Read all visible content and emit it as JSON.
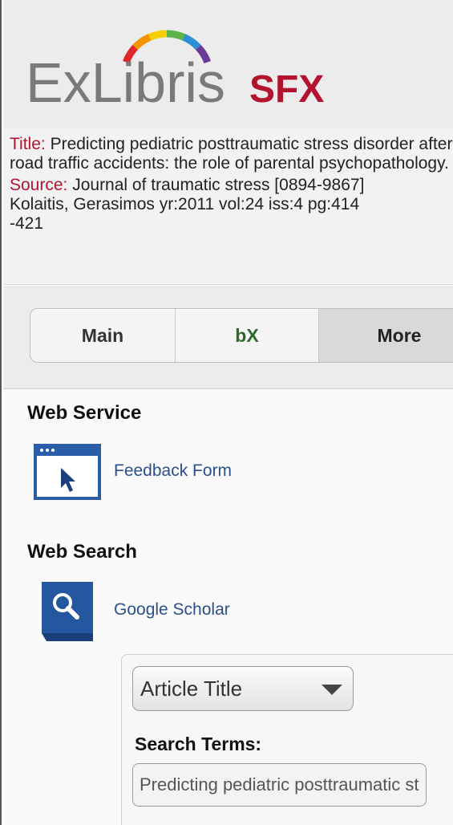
{
  "brand": {
    "name": "ExLibris",
    "product": "SFX",
    "arc_colors": [
      "#e0262a",
      "#f29300",
      "#f5cf00",
      "#5ab447",
      "#2a8fd4",
      "#6a3c97"
    ]
  },
  "citation": {
    "title_label": "Title:",
    "title_value": " Predicting pediatric posttraumatic stress disorder after road traffic accidents: the role of parental psychopathology.",
    "source_label": "Source:",
    "source_line1": " Journal of traumatic stress [0894-9867]",
    "source_line2": "Kolaitis, Gerasimos yr:2011 vol:24 iss:4 pg:414",
    "source_line3": "-421"
  },
  "tabs": [
    {
      "label": "Main",
      "selected": false
    },
    {
      "label": "bX",
      "selected": false
    },
    {
      "label": "More",
      "selected": true
    }
  ],
  "sections": {
    "web_service": {
      "title": "Web Service",
      "link": "Feedback Form",
      "icon": "browser-pointer-icon"
    },
    "web_search": {
      "title": "Web Search",
      "link": "Google Scholar",
      "icon": "magnifier-icon"
    }
  },
  "search": {
    "field_select": "Article Title",
    "terms_label": "Search Terms:",
    "terms_value": "Predicting pediatric posttraumatic stress disorder after road traffic accidents: the role of parental psychopathology."
  }
}
